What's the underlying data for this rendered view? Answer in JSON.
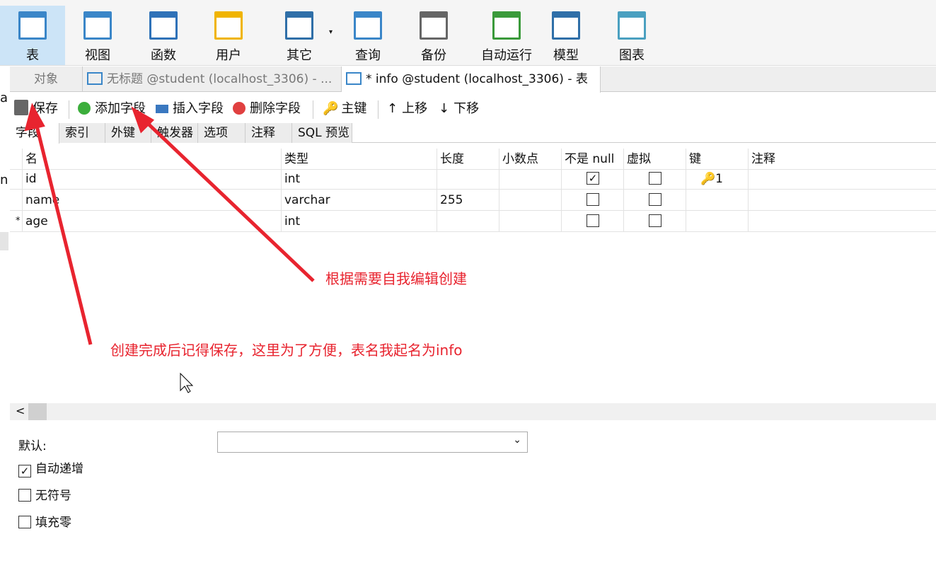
{
  "ribbon": [
    {
      "label": "表",
      "icon": "table-icon",
      "selected": true
    },
    {
      "label": "视图",
      "icon": "view-icon"
    },
    {
      "label": "函数",
      "icon": "function-icon"
    },
    {
      "label": "用户",
      "icon": "user-icon"
    },
    {
      "label": "其它",
      "icon": "tools-icon"
    },
    {
      "label": "查询",
      "icon": "query-icon"
    },
    {
      "label": "备份",
      "icon": "backup-icon"
    },
    {
      "label": "自动运行",
      "icon": "schedule-icon"
    },
    {
      "label": "模型",
      "icon": "model-icon"
    },
    {
      "label": "图表",
      "icon": "chart-icon"
    }
  ],
  "left_clip": [
    "a",
    "na"
  ],
  "tabs": {
    "objects": "对象",
    "untitled": "无标题 @student (localhost_3306) - ...",
    "info": "* info @student (localhost_3306) - 表"
  },
  "toolbar": {
    "save": "保存",
    "add_field": "添加字段",
    "insert_field": "插入字段",
    "delete_field": "删除字段",
    "primary_key": "主键",
    "move_up": "上移",
    "move_down": "下移"
  },
  "subtabs": [
    "字段",
    "索引",
    "外键",
    "触发器",
    "选项",
    "注释",
    "SQL 预览"
  ],
  "columns": [
    "名",
    "类型",
    "长度",
    "小数点",
    "不是 null",
    "虚拟",
    "键",
    "注释"
  ],
  "rows": [
    {
      "marker": "",
      "name": "id",
      "type": "int",
      "length": "",
      "decimals": "",
      "not_null": true,
      "virtual": false,
      "key": "1"
    },
    {
      "marker": "",
      "name": "name",
      "type": "varchar",
      "length": "255",
      "decimals": "",
      "not_null": false,
      "virtual": false,
      "key": ""
    },
    {
      "marker": "*",
      "name": "age",
      "type": "int",
      "length": "",
      "decimals": "",
      "not_null": false,
      "virtual": false,
      "key": ""
    }
  ],
  "lower": {
    "default_label": "默认:",
    "default_value": "",
    "auto_increment": "自动递增",
    "auto_increment_checked": true,
    "unsigned": "无符号",
    "unsigned_checked": false,
    "zerofill": "填充零",
    "zerofill_checked": false
  },
  "annotations": {
    "edit_note": "根据需要自我编辑创建",
    "save_note": "创建完成后记得保存，这里为了方便，表名我起名为info",
    "color": "#e8242f"
  }
}
